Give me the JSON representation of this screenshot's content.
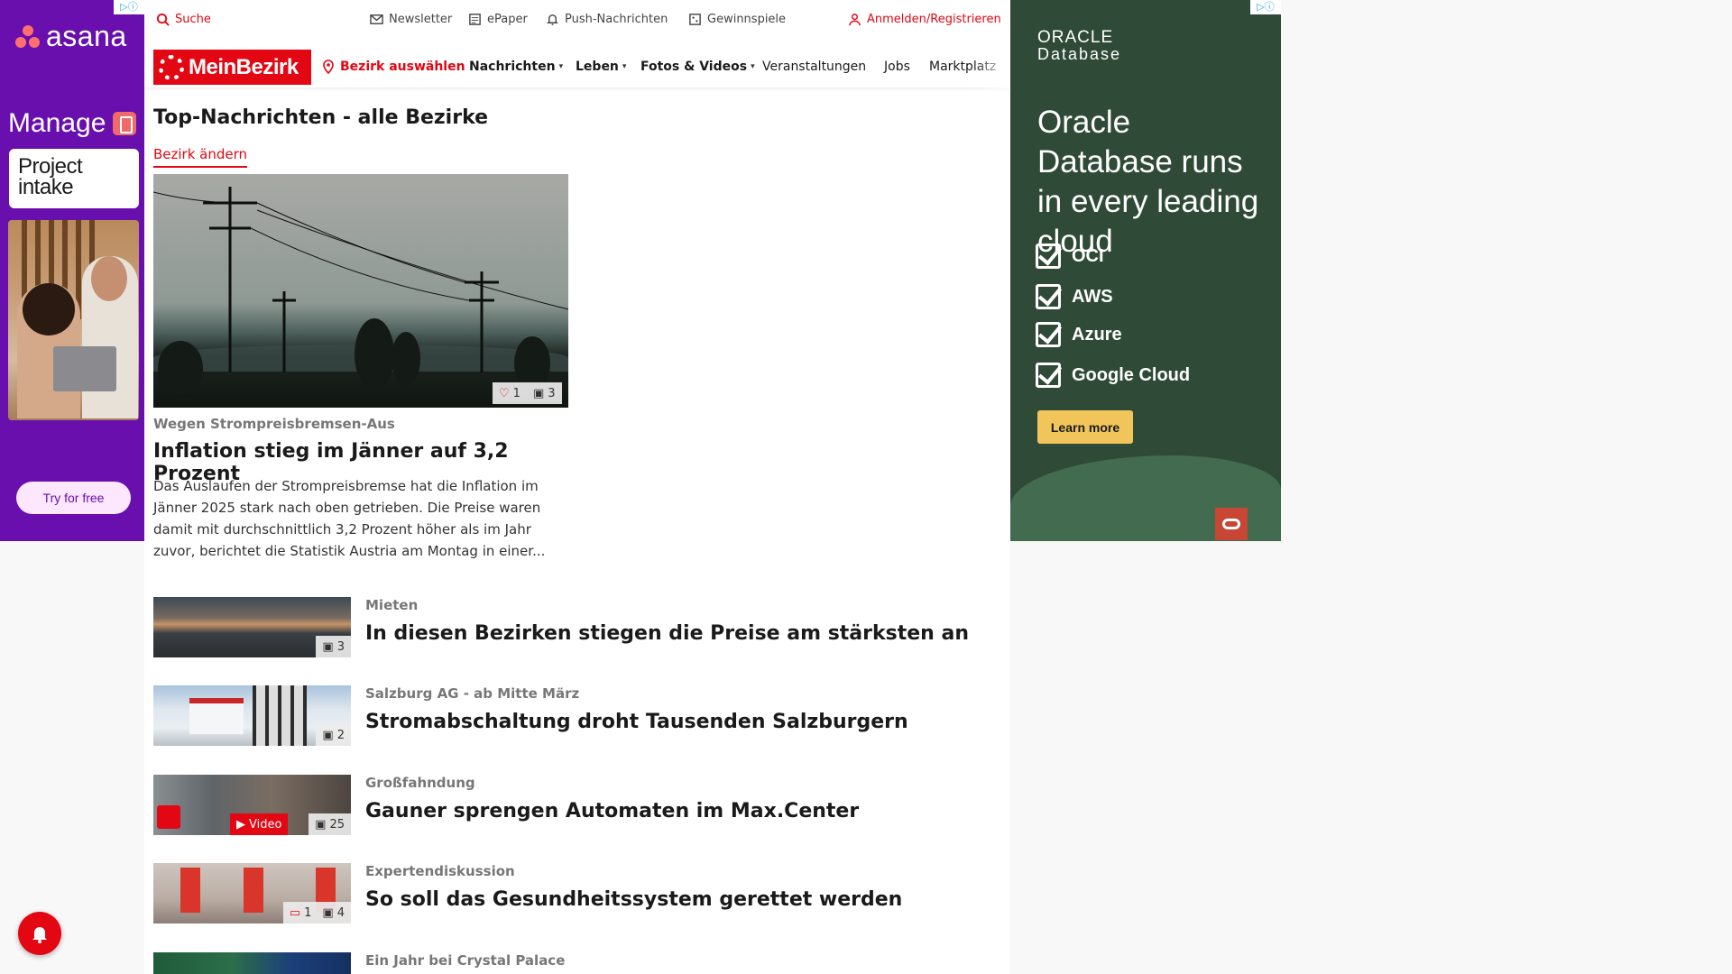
{
  "left_ad": {
    "brand": "asana",
    "manage": "Manage",
    "card_line1": "Project",
    "card_line2": "intake",
    "cta": "Try for free",
    "adchoice": "▷ⓘ"
  },
  "topbar": {
    "search": "Suche",
    "newsletter": "Newsletter",
    "epaper": "ePaper",
    "push": "Push-Nachrichten",
    "gewinnspiele": "Gewinnspiele",
    "login": "Anmelden/Registrieren"
  },
  "nav": {
    "logo": "MeinBezirk",
    "bezirk_select": "Bezirk auswählen",
    "items": [
      "Nachrichten",
      "Leben",
      "Fotos & Videos",
      "Veranstaltungen",
      "Jobs",
      "Marktplatz"
    ]
  },
  "section": {
    "title": "Top-Nachrichten - alle Bezirke",
    "change_link": "Bezirk ändern"
  },
  "hero": {
    "likes": "1",
    "photos": "3",
    "kicker": "Wegen Strompreisbremsen-Aus",
    "title": "Inflation stieg im Jänner auf 3,2 Prozent",
    "teaser": "Das Auslaufen der Strompreisbremse hat die Inflation im Jänner 2025 stark nach oben getrieben. Die Preise waren damit mit durchschnittlich 3,2 Prozent höher als im Jahr zuvor, berichtet die Statistik Austria am Montag in einer..."
  },
  "articles": [
    {
      "kicker": "Mieten",
      "title": "In diesen Bezirken stiegen die Preise am stärksten an",
      "photos": "3"
    },
    {
      "kicker": "Salzburg AG - ab Mitte März",
      "title": "Stromabschaltung droht Tausenden Salzburgern",
      "photos": "2"
    },
    {
      "kicker": "Großfahndung",
      "title": "Gauner sprengen Automaten im Max.Center",
      "photos": "25",
      "video": "Video"
    },
    {
      "kicker": "Expertendiskussion",
      "title": "So soll das Gesundheitssystem gerettet werden",
      "photos": "4",
      "comments": "1"
    },
    {
      "kicker": "Ein Jahr bei Crystal Palace",
      "title": ""
    }
  ],
  "right_ad": {
    "logo_top": "ORACLE",
    "logo_bottom": "Database",
    "headline": "Oracle Database runs in every leading cloud",
    "clouds": [
      "OCI",
      "AWS",
      "Azure",
      "Google Cloud"
    ],
    "cta": "Learn more",
    "adchoice": "▷ⓘ"
  }
}
